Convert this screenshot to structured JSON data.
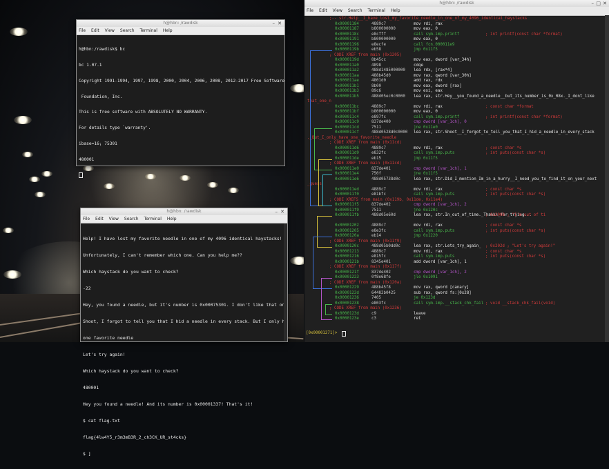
{
  "bc_window": {
    "title": "h@hbn: /rawdisk",
    "menu": [
      "File",
      "Edit",
      "View",
      "Search",
      "Terminal",
      "Help"
    ],
    "lines": [
      "h@hbn:/rawdisk$ bc",
      "bc 1.07.1",
      "Copyright 1991-1994, 1997, 1998, 2000, 2004, 2006, 2008, 2012-2017 Free Software",
      " Foundation, Inc.",
      "This is free software with ABSOLUTELY NO WARRANTY.",
      "For details type `warranty'.",
      "ibase=16; 75301",
      "480001"
    ]
  },
  "haystack_window": {
    "title": "h@hbn: /rawdisk",
    "menu": [
      "File",
      "Edit",
      "View",
      "Search",
      "Terminal",
      "Help"
    ],
    "lines": [
      "Help! I have lost my favorite needle in one of my 4096 identical haystacks!",
      "Unfortunately, I can't remember which one. Can you help me??",
      "Which haystack do you want to check?",
      "-22",
      "Hey, you found a needle, but it's number is 0x00075301. I don't like that one",
      "Shoot, I forgot to tell you that I hid a needle in every stack. But I only have",
      "one favorite needle",
      "Let's try again!",
      "Which haystack do you want to check?",
      "480001",
      "Hey you found a needle! And its number is 0x00001337! That's it!",
      "$ cat flag.txt",
      "flag{4lw4Y5_r3m3mB3R_2_ch3CK_UR_st4cks}",
      "$ ]"
    ]
  },
  "r2_window": {
    "title": "h@hbn: /rawdisk",
    "menu": [
      "File",
      "Edit",
      "View",
      "Search",
      "Terminal",
      "Help"
    ],
    "prompt": "[0x00001271]>",
    "rows": [
      {
        "k": "cmt",
        "txt": ";-- str.Help__I_have_lost_my_favorite_needle_in_one_of_my_4096_identical_haystacks"
      },
      {
        "k": "ins",
        "addr": "0x00001184",
        "bytes": "4889c7",
        "op": "mov rdi, rax",
        "cmt": ""
      },
      {
        "k": "ins",
        "addr": "0x00001187",
        "bytes": "b800000000",
        "op": "mov eax, 0",
        "cmt": ""
      },
      {
        "k": "ins",
        "addr": "0x0000118c",
        "bytes": "e8cfff",
        "op": "call sym.imp.printf",
        "cmt": "; int printf(const char *format)"
      },
      {
        "k": "ins",
        "addr": "0x00001191",
        "bytes": "b800000000",
        "op": "mov eax, 0",
        "cmt": ""
      },
      {
        "k": "ins",
        "addr": "0x00001196",
        "bytes": "e8ecfe",
        "op": "call fcn.000011e9",
        "cmt": ""
      },
      {
        "k": "ins",
        "addr": "0x0000119b",
        "bytes": "eb58",
        "op": "jmp 0x11f5",
        "cmt": ""
      },
      {
        "k": "cmt",
        "txt": "; CODE XREF from main (0x1205)"
      },
      {
        "k": "ins",
        "addr": "0x0000119d",
        "bytes": "8b45cc",
        "op": "mov eax, dword [var_34h]",
        "cmt": ""
      },
      {
        "k": "ins",
        "addr": "0x000011a0",
        "bytes": "4898",
        "op": "cdqe",
        "cmt": ""
      },
      {
        "k": "ins",
        "addr": "0x000011a2",
        "bytes": "488d1485000000",
        "op": "lea rdx, [rax*4]",
        "cmt": ""
      },
      {
        "k": "ins",
        "addr": "0x000011aa",
        "bytes": "488b45d0",
        "op": "mov rax, qword [var_30h]",
        "cmt": ""
      },
      {
        "k": "ins",
        "addr": "0x000011ae",
        "bytes": "4801d0",
        "op": "add rax, rdx",
        "cmt": ""
      },
      {
        "k": "ins",
        "addr": "0x000011b1",
        "bytes": "8b00",
        "op": "mov eax, dword [rax]",
        "cmt": ""
      },
      {
        "k": "ins",
        "addr": "0x000011b3",
        "bytes": "89c6",
        "op": "mov esi, eax",
        "cmt": ""
      },
      {
        "k": "ins",
        "addr": "0x000011b5",
        "bytes": "488d05ec0c0000",
        "op": "lea rax, str.Hey__you_found_a_needle__but_its_number_is_0x_08x._I_dont_like",
        "cmt": ""
      },
      {
        "k": "wrap",
        "txt": "that_one_n"
      },
      {
        "k": "ins",
        "addr": "0x000011bc",
        "bytes": "4889c7",
        "op": "mov rdi, rax",
        "cmt": "; const char *format"
      },
      {
        "k": "ins",
        "addr": "0x000011bf",
        "bytes": "b800000000",
        "op": "mov eax, 0",
        "cmt": ""
      },
      {
        "k": "ins",
        "addr": "0x000011c4",
        "bytes": "e897fc",
        "op": "call sym.imp.printf",
        "cmt": "; int printf(const char *format)"
      },
      {
        "k": "ins",
        "addr": "0x000011c9",
        "bytes": "837de400",
        "op": "cmp dword [var_1ch], 0",
        "cmt": ""
      },
      {
        "k": "ins",
        "addr": "0x000011cd",
        "bytes": "7511",
        "op": "jne 0x11e0",
        "cmt": ""
      },
      {
        "k": "ins",
        "addr": "0x000011cf",
        "bytes": "488d0528d0c0000",
        "op": "lea rax, str.Shoot__I_forgot_to_tell_you_that_I_hid_a_needle_in_every_stack",
        "cmt": ""
      },
      {
        "k": "wrap",
        "txt": "._But_I_only_have_one_favorite_needle"
      },
      {
        "k": "cmt",
        "txt": "; CODE XREF from main (0x11cd)"
      },
      {
        "k": "ins",
        "addr": "0x000011d6",
        "bytes": "4889c7",
        "op": "mov rdi, rax",
        "cmt": "; const char *s"
      },
      {
        "k": "ins",
        "addr": "0x000011d9",
        "bytes": "e832fc",
        "op": "call sym.imp.puts",
        "cmt": "; int puts(const char *s)"
      },
      {
        "k": "ins",
        "addr": "0x000011de",
        "bytes": "eb15",
        "op": "jmp 0x11f5",
        "cmt": ""
      },
      {
        "k": "cmt",
        "txt": "; CODE XREF from main (0x11cd)"
      },
      {
        "k": "ins",
        "addr": "0x000011e0",
        "bytes": "837de401",
        "op": "cmp dword [var_1ch], 1",
        "cmt": ""
      },
      {
        "k": "ins",
        "addr": "0x000011e4",
        "bytes": "750f",
        "op": "jne 0x11f5",
        "cmt": ""
      },
      {
        "k": "ins",
        "addr": "0x000011e6",
        "bytes": "488d05738d0c",
        "op": "lea rax, str.Did_I_mention_Im_in_a_hurry__I_need_you_to_find_it_on_your_next",
        "cmt": ""
      },
      {
        "k": "wrap",
        "txt": "_guess"
      },
      {
        "k": "ins",
        "addr": "0x000011ed",
        "bytes": "4889c7",
        "op": "mov rdi, rax",
        "cmt": "; const char *s"
      },
      {
        "k": "ins",
        "addr": "0x000011f0",
        "bytes": "e81bfc",
        "op": "call sym.imp.puts",
        "cmt": "; int puts(const char *s)"
      },
      {
        "k": "cmt",
        "txt": "; CODE XREFS from main (0x119b, 0x11de, 0x11e4)"
      },
      {
        "k": "ins",
        "addr": "0x000011f5",
        "bytes": "837de402",
        "op": "cmp dword [var_1ch], 2",
        "cmt": ""
      },
      {
        "k": "ins",
        "addr": "0x000011f9",
        "bytes": "7511",
        "op": "jne 0x120c",
        "cmt": ""
      },
      {
        "k": "ins",
        "addr": "0x000011fb",
        "bytes": "488d05e60d",
        "op": "lea rax, str.In_out_of_time._Thanks_for_trying...",
        "cmt": "; 0x2008 ; \"I'm out of ti"
      },
      {
        "k": "wrap",
        "txt": ""
      },
      {
        "k": "ins",
        "addr": "0x00001202",
        "bytes": "4889c7",
        "op": "mov rdi, rax",
        "cmt": "; const char *s"
      },
      {
        "k": "ins",
        "addr": "0x00001205",
        "bytes": "e8e3fc",
        "op": "call sym.imp.puts",
        "cmt": "; int puts(const char *s)"
      },
      {
        "k": "ins",
        "addr": "0x0000120a",
        "bytes": "eb14",
        "op": "jmp 0x1220",
        "cmt": ""
      },
      {
        "k": "cmt",
        "txt": "; CODE XREF from main (0x11f9)"
      },
      {
        "k": "ins",
        "addr": "0x0000120c",
        "bytes": "488d05b0dd0c",
        "op": "lea rax, str.Lets_try_again_",
        "cmt": "; 0x202d ; \"Let's try again!\""
      },
      {
        "k": "ins",
        "addr": "0x00001213",
        "bytes": "4889c7",
        "op": "mov rdi, rax",
        "cmt": "; const char *s"
      },
      {
        "k": "ins",
        "addr": "0x00001216",
        "bytes": "e815fc",
        "op": "call sym.imp.puts",
        "cmt": "; int puts(const char *s)"
      },
      {
        "k": "ins",
        "addr": "0x0000121b",
        "bytes": "8345e401",
        "op": "add dword [var_1ch], 1",
        "cmt": ""
      },
      {
        "k": "cmt",
        "txt": "; CODE XREF from main (0x117f)"
      },
      {
        "k": "ins",
        "addr": "0x0000121f",
        "bytes": "837de402",
        "op": "cmp dword [var_1ch], 2",
        "cmt": ""
      },
      {
        "k": "ins",
        "addr": "0x00001223",
        "bytes": "0f8e68fe",
        "op": "jle 0x1091",
        "cmt": ""
      },
      {
        "k": "cmt",
        "txt": "; CODE XREF from main (0x120a)"
      },
      {
        "k": "ins",
        "addr": "0x00001229",
        "bytes": "488b45f8",
        "op": "mov rax, qword [canary]",
        "cmt": ""
      },
      {
        "k": "ins",
        "addr": "0x0000122d",
        "bytes": "64482b0425",
        "op": "sub rax, qword fs:[0x28]",
        "cmt": ""
      },
      {
        "k": "ins",
        "addr": "0x00001236",
        "bytes": "7405",
        "op": "je 0x123d",
        "cmt": ""
      },
      {
        "k": "ins",
        "addr": "0x00001238",
        "bytes": "e803fc",
        "op": "call sym.imp.__stack_chk_fail",
        "cmt": "; void __stack_chk_fail(void)"
      },
      {
        "k": "cmt",
        "txt": "; CODE XREF from main (0x1236)"
      },
      {
        "k": "ins",
        "addr": "0x0000123d",
        "bytes": "c9",
        "op": "leave",
        "cmt": ""
      },
      {
        "k": "ins",
        "addr": "0x0000123e",
        "bytes": "c3",
        "op": "ret",
        "cmt": ""
      }
    ]
  }
}
